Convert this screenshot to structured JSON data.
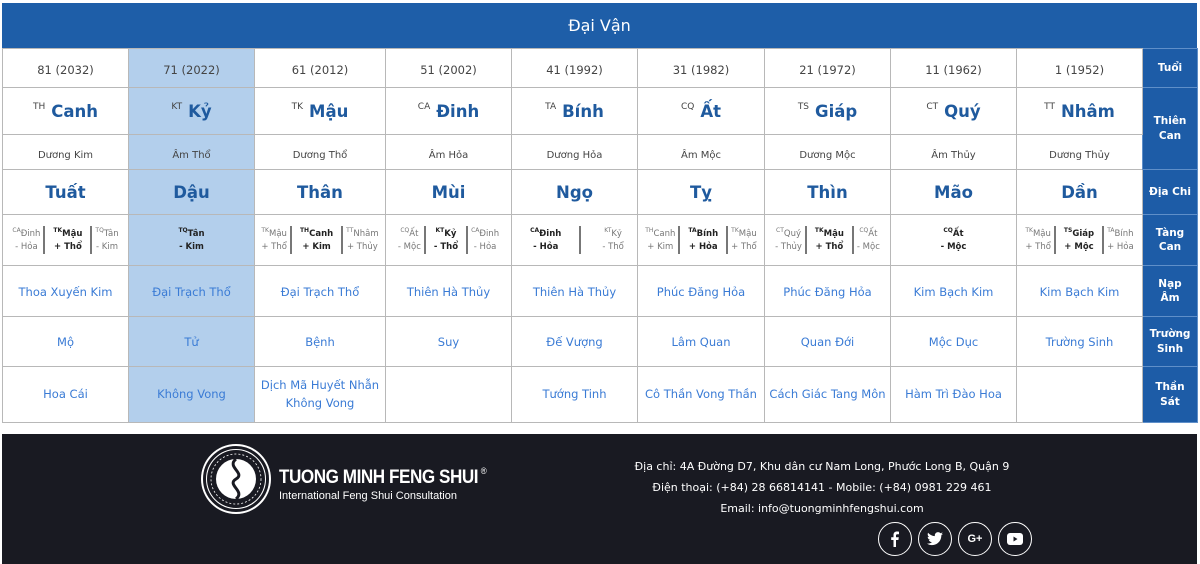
{
  "title": "Đại Vận",
  "labels": {
    "tuoi": "Tuổi",
    "thien_can_1": "Thiên",
    "thien_can_2": "Can",
    "dia_chi": "Địa Chi",
    "tang_can_1": "Tàng",
    "tang_can_2": "Can",
    "nap_am_1": "Nạp",
    "nap_am_2": "Âm",
    "truong_sinh_1": "Trường",
    "truong_sinh_2": "Sinh",
    "than_sat_1": "Thần",
    "than_sat_2": "Sát"
  },
  "highlight_color": "#b3cfec",
  "accent_color": "#1d5ca7",
  "columns": [
    {
      "age": "81 (2032)",
      "can_abbr": "TH",
      "can": "Canh",
      "can_element": "Dương Kim",
      "chi": "Tuất",
      "tang": [
        {
          "abbr": "CA",
          "name": "Đinh",
          "el": "- Hỏa"
        },
        {
          "abbr": "TK",
          "name": "Mậu",
          "el": "+ Thổ"
        },
        {
          "abbr": "TQ",
          "name": "Tân",
          "el": "- Kim"
        }
      ],
      "nap_am": "Thoa Xuyến Kim",
      "truong_sinh": "Mộ",
      "than_sat": [
        "Hoa Cái"
      ]
    },
    {
      "age": "71 (2022)",
      "can_abbr": "KT",
      "can": "Kỷ",
      "can_element": "Âm Thổ",
      "chi": "Dậu",
      "highlighted": true,
      "tang": [
        {
          "abbr": "TQ",
          "name": "Tân",
          "el": "- Kim"
        }
      ],
      "nap_am": "Đại Trạch Thổ",
      "truong_sinh": "Tử",
      "than_sat": [
        "Không Vong"
      ]
    },
    {
      "age": "61 (2012)",
      "can_abbr": "TK",
      "can": "Mậu",
      "can_element": "Dương Thổ",
      "chi": "Thân",
      "tang": [
        {
          "abbr": "TK",
          "name": "Mậu",
          "el": "+ Thổ"
        },
        {
          "abbr": "TH",
          "name": "Canh",
          "el": "+ Kim"
        },
        {
          "abbr": "TT",
          "name": "Nhâm",
          "el": "+ Thủy"
        }
      ],
      "nap_am": "Đại Trạch Thổ",
      "truong_sinh": "Bệnh",
      "than_sat": [
        "Dịch Mã Huyết Nhẫn",
        "Không Vong"
      ]
    },
    {
      "age": "51 (2002)",
      "can_abbr": "CA",
      "can": "Đinh",
      "can_element": "Âm Hỏa",
      "chi": "Mùi",
      "tang": [
        {
          "abbr": "CQ",
          "name": "Ất",
          "el": "- Mộc"
        },
        {
          "abbr": "KT",
          "name": "Kỷ",
          "el": "- Thổ"
        },
        {
          "abbr": "CA",
          "name": "Đinh",
          "el": "- Hỏa"
        }
      ],
      "nap_am": "Thiên Hà Thủy",
      "truong_sinh": "Suy",
      "than_sat": []
    },
    {
      "age": "41 (1992)",
      "can_abbr": "TA",
      "can": "Bính",
      "can_element": "Dương Hỏa",
      "chi": "Ngọ",
      "tang": [
        {
          "abbr": "CA",
          "name": "Đinh",
          "el": "- Hỏa"
        },
        {
          "abbr": "KT",
          "name": "Kỷ",
          "el": "- Thổ"
        }
      ],
      "nap_am": "Thiên Hà Thủy",
      "truong_sinh": "Đế Vượng",
      "than_sat": [
        "Tướng Tinh"
      ]
    },
    {
      "age": "31 (1982)",
      "can_abbr": "CQ",
      "can": "Ất",
      "can_element": "Âm Mộc",
      "chi": "Tỵ",
      "tang": [
        {
          "abbr": "TH",
          "name": "Canh",
          "el": "+ Kim"
        },
        {
          "abbr": "TA",
          "name": "Bính",
          "el": "+ Hỏa"
        },
        {
          "abbr": "TK",
          "name": "Mậu",
          "el": "+ Thổ"
        }
      ],
      "nap_am": "Phúc Đăng Hỏa",
      "truong_sinh": "Lâm Quan",
      "than_sat": [
        "Cô Thần Vong Thần"
      ]
    },
    {
      "age": "21 (1972)",
      "can_abbr": "TS",
      "can": "Giáp",
      "can_element": "Dương Mộc",
      "chi": "Thìn",
      "tang": [
        {
          "abbr": "CT",
          "name": "Quý",
          "el": "- Thủy"
        },
        {
          "abbr": "TK",
          "name": "Mậu",
          "el": "+ Thổ"
        },
        {
          "abbr": "CQ",
          "name": "Ất",
          "el": "- Mộc"
        }
      ],
      "nap_am": "Phúc Đăng Hỏa",
      "truong_sinh": "Quan Đới",
      "than_sat": [
        "Cách Giác Tang Môn"
      ]
    },
    {
      "age": "11 (1962)",
      "can_abbr": "CT",
      "can": "Quý",
      "can_element": "Âm Thủy",
      "chi": "Mão",
      "tang": [
        {
          "abbr": "CQ",
          "name": "Ất",
          "el": "- Mộc"
        }
      ],
      "nap_am": "Kim Bạch Kim",
      "truong_sinh": "Mộc Dục",
      "than_sat": [
        "Hàm Trì Đào Hoa"
      ]
    },
    {
      "age": "1 (1952)",
      "can_abbr": "TT",
      "can": "Nhâm",
      "can_element": "Dương Thủy",
      "chi": "Dần",
      "tang": [
        {
          "abbr": "TK",
          "name": "Mậu",
          "el": "+ Thổ"
        },
        {
          "abbr": "TS",
          "name": "Giáp",
          "el": "+ Mộc"
        },
        {
          "abbr": "TA",
          "name": "Bính",
          "el": "+ Hỏa"
        }
      ],
      "nap_am": "Kim Bạch Kim",
      "truong_sinh": "Trường Sinh",
      "than_sat": []
    }
  ],
  "footer": {
    "brand": "TUONG MINH FENG SHUI",
    "registered": "®",
    "tagline": "International Feng Shui Consultation",
    "address": "Địa chỉ: 4A Đường D7, Khu dân cư Nam Long, Phước Long B, Quận 9",
    "phone": "Điện thoại: (+84) 28 66814141 - Mobile: (+84) 0981 229 461",
    "email": "Email: info@tuongminhfengshui.com",
    "social": [
      {
        "name": "facebook",
        "glyph": "f"
      },
      {
        "name": "twitter",
        "glyph": "🐦"
      },
      {
        "name": "google-plus",
        "glyph": "G+"
      },
      {
        "name": "youtube",
        "glyph": "▶"
      }
    ]
  }
}
